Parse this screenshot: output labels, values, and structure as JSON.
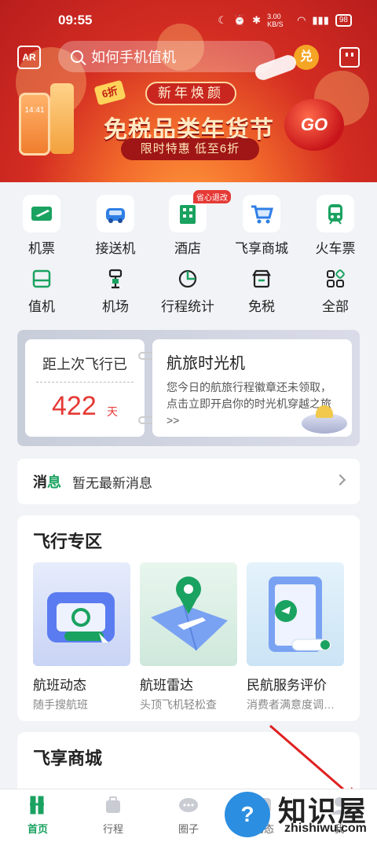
{
  "status_bar": {
    "time": "09:55",
    "net_speed": "3.00 KB/S",
    "battery": "98"
  },
  "header": {
    "ar_label": "AR",
    "search_placeholder": "如何手机值机",
    "redeem_label": "兑"
  },
  "banner": {
    "headline": "免税品类年货节",
    "tagline": "新年焕颜",
    "pill": "限时特惠 低至6折",
    "discount_badge": "6折",
    "go_label": "GO",
    "phone_time": "14:41"
  },
  "services_row1": [
    {
      "label": "机票",
      "icon": "ticket-plane-icon"
    },
    {
      "label": "接送机",
      "icon": "car-icon"
    },
    {
      "label": "酒店",
      "icon": "hotel-icon",
      "tag": "省心退改"
    },
    {
      "label": "飞享商城",
      "icon": "cart-icon"
    },
    {
      "label": "火车票",
      "icon": "train-icon"
    }
  ],
  "services_row2": [
    {
      "label": "值机",
      "icon": "checkin-icon"
    },
    {
      "label": "机场",
      "icon": "airport-icon"
    },
    {
      "label": "行程统计",
      "icon": "pie-chart-icon"
    },
    {
      "label": "免税",
      "icon": "shop-icon"
    },
    {
      "label": "全部",
      "icon": "grid-all-icon"
    }
  ],
  "last_flight": {
    "title": "距上次飞行已",
    "days": "422",
    "unit": "天"
  },
  "time_machine": {
    "title": "航旅时光机",
    "desc": "您今日的航旅行程徽章还未领取，点击立即开启你的时光机穿越之旅 >>"
  },
  "news": {
    "label_a": "消",
    "label_b": "息",
    "text": "暂无最新消息"
  },
  "flight_zone": {
    "title": "飞行专区",
    "cards": [
      {
        "name": "航班动态",
        "sub": "随手搜航班"
      },
      {
        "name": "航班雷达",
        "sub": "头顶飞机轻松查"
      },
      {
        "name": "民航服务评价",
        "sub": "消费者满意度调…"
      }
    ]
  },
  "mall": {
    "title": "飞享商城"
  },
  "tabs": [
    {
      "label": "首页",
      "active": true
    },
    {
      "label": "行程",
      "active": false
    },
    {
      "label": "圈子",
      "active": false
    },
    {
      "label": "动态",
      "active": false
    },
    {
      "label": "我",
      "active": false
    }
  ],
  "watermark": {
    "logo": "?",
    "text": "知识屋",
    "url": "zhishiwu.com"
  },
  "colors": {
    "brand_green": "#1aa260",
    "hero_red": "#d42d22",
    "accent_red": "#e53935"
  }
}
